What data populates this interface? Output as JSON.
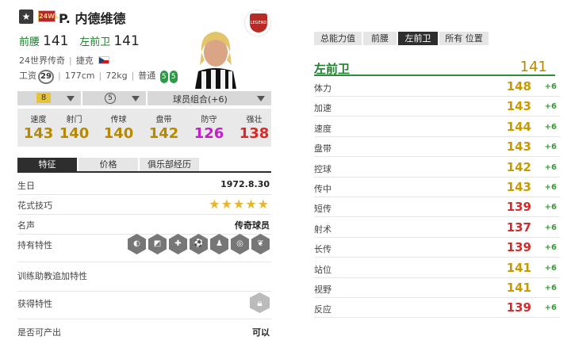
{
  "header": {
    "season_badge": "24WL",
    "player_name": "P. 内德维德",
    "positions": [
      {
        "pos": "前腰",
        "ovr": "141"
      },
      {
        "pos": "左前卫",
        "ovr": "141"
      }
    ],
    "season_text": "24世界传奇",
    "nation": "捷克",
    "salary_label": "工资",
    "salary": "29",
    "height": "177cm",
    "weight": "72kg",
    "body_type": "普通",
    "left_foot": "5",
    "right_foot": "5",
    "legend_badge_text": "LEGEND"
  },
  "selectors": {
    "level": "8",
    "upgrade": "5",
    "team_chem": "球员组合(+6)"
  },
  "stats": [
    {
      "label": "速度",
      "value": "143",
      "color": "#b58a00"
    },
    {
      "label": "射门",
      "value": "140",
      "color": "#b58a00"
    },
    {
      "label": "传球",
      "value": "140",
      "color": "#b58a00"
    },
    {
      "label": "盘带",
      "value": "142",
      "color": "#b58a00"
    },
    {
      "label": "防守",
      "value": "126",
      "color": "#c21fc9"
    },
    {
      "label": "强壮",
      "value": "138",
      "color": "#d42b2b"
    }
  ],
  "left_tabs": [
    "特征",
    "价格",
    "俱乐部经历"
  ],
  "details": {
    "birthday_label": "生日",
    "birthday": "1972.8.30",
    "skill_label": "花式技巧",
    "skill_stars": "★★★★★",
    "fame_label": "名声",
    "fame": "传奇球员",
    "traits_label": "持有特性",
    "training_label": "训练助教追加特性",
    "acquired_label": "获得特性",
    "producible_label": "是否可产出",
    "producible": "可以"
  },
  "right_tabs": [
    "总能力值",
    "前腰",
    "左前卫",
    "所有 位置"
  ],
  "position_detail": {
    "position": "左前卫",
    "ovr": "141",
    "rows": [
      {
        "label": "体力",
        "value": "148",
        "bonus": "+6",
        "color": "#c99a00"
      },
      {
        "label": "加速",
        "value": "143",
        "bonus": "+6",
        "color": "#c99a00"
      },
      {
        "label": "速度",
        "value": "144",
        "bonus": "+6",
        "color": "#c99a00"
      },
      {
        "label": "盘带",
        "value": "143",
        "bonus": "+6",
        "color": "#c99a00"
      },
      {
        "label": "控球",
        "value": "142",
        "bonus": "+6",
        "color": "#c99a00"
      },
      {
        "label": "传中",
        "value": "143",
        "bonus": "+6",
        "color": "#c99a00"
      },
      {
        "label": "短传",
        "value": "139",
        "bonus": "+6",
        "color": "#d42b2b"
      },
      {
        "label": "射术",
        "value": "137",
        "bonus": "+6",
        "color": "#d42b2b"
      },
      {
        "label": "长传",
        "value": "139",
        "bonus": "+6",
        "color": "#d42b2b"
      },
      {
        "label": "站位",
        "value": "141",
        "bonus": "+6",
        "color": "#c99a00"
      },
      {
        "label": "视野",
        "value": "141",
        "bonus": "+6",
        "color": "#c99a00"
      },
      {
        "label": "反应",
        "value": "139",
        "bonus": "+6",
        "color": "#d42b2b"
      }
    ]
  }
}
